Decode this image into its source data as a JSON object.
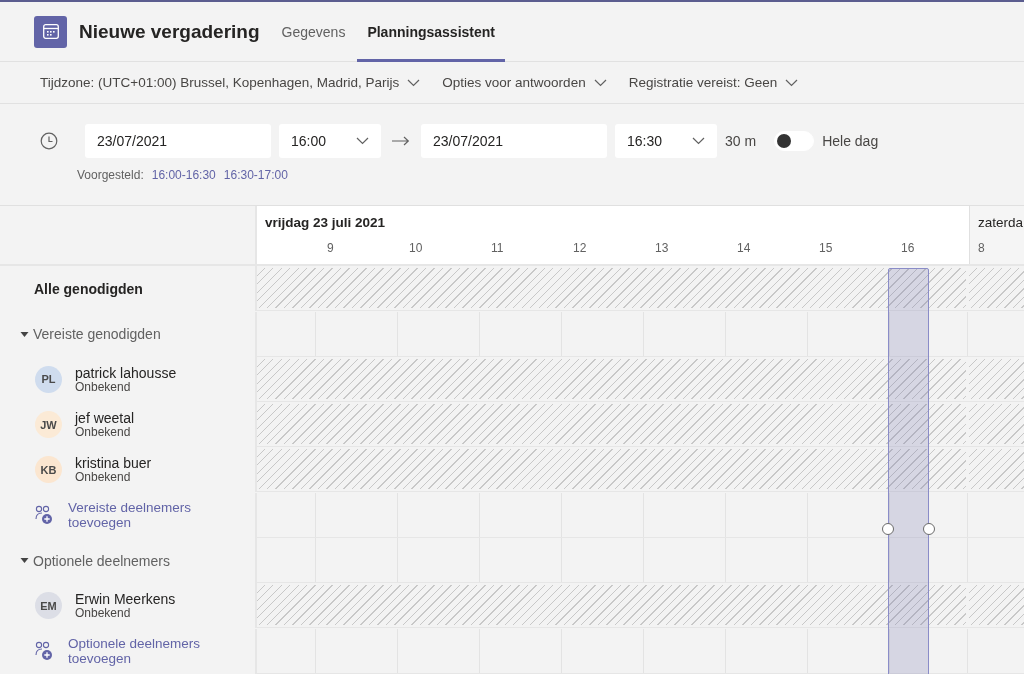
{
  "header": {
    "title": "Nieuwe vergadering",
    "tabs": [
      {
        "label": "Gegevens",
        "selected": false
      },
      {
        "label": "Planningsassistent",
        "selected": true
      }
    ]
  },
  "options": [
    {
      "label": "Tijdzone: (UTC+01:00) Brussel, Kopenhagen, Madrid, Parijs"
    },
    {
      "label": "Opties voor antwoorden"
    },
    {
      "label": "Registratie vereist: Geen"
    }
  ],
  "time": {
    "start_date": "23/07/2021",
    "start_time": "16:00",
    "end_date": "23/07/2021",
    "end_time": "16:30",
    "duration": "30 m",
    "all_day": {
      "label": "Hele dag",
      "on": false
    },
    "suggested": {
      "label": "Voorgesteld:",
      "slots": [
        "16:00-16:30",
        "16:30-17:00"
      ]
    }
  },
  "days": [
    {
      "label": "vrijdag 23 juli 2021",
      "hours": [
        "9",
        "10",
        "11",
        "12",
        "13",
        "14",
        "15",
        "16"
      ]
    },
    {
      "label": "zaterda",
      "hours": [
        "8"
      ]
    }
  ],
  "rows": [
    {
      "kind": "all",
      "label": "Alle genodigden",
      "busy": true
    },
    {
      "kind": "group",
      "label": "Vereiste genodigden",
      "expanded": true,
      "busy": false
    },
    {
      "kind": "person",
      "initials": "PL",
      "name": "patrick lahousse",
      "status": "Onbekend",
      "color": "#cfdcee",
      "busy": true
    },
    {
      "kind": "person",
      "initials": "JW",
      "name": "jef weetal",
      "status": "Onbekend",
      "color": "#fbead6",
      "busy": true
    },
    {
      "kind": "person",
      "initials": "KB",
      "name": "kristina buer",
      "status": "Onbekend",
      "color": "#fbe6d0",
      "busy": true
    },
    {
      "kind": "add",
      "label": "Vereiste deelnemers toevoegen",
      "busy": false
    },
    {
      "kind": "group",
      "label": "Optionele deelnemers",
      "expanded": true,
      "busy": false
    },
    {
      "kind": "person",
      "initials": "EM",
      "name": "Erwin Meerkens",
      "status": "Onbekend",
      "color": "#dcdee6",
      "busy": true
    },
    {
      "kind": "add",
      "label": "Optionele deelnemers toevoegen",
      "busy": false
    }
  ]
}
